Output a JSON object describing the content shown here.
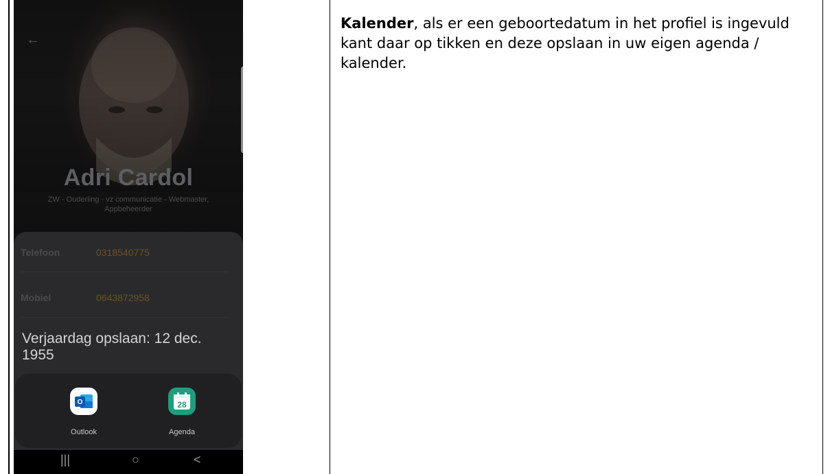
{
  "profile": {
    "name": "Adri Cardol",
    "role": "ZW - Ouderling - vz communicatie - Webmaster, Appbeheerder"
  },
  "contact_rows": [
    {
      "label": "Telefoon",
      "value": "0318540775"
    },
    {
      "label": "Mobiel",
      "value": "0643872958"
    }
  ],
  "toast": {
    "text": "Verjaardag opslaan: 12 dec. 1955"
  },
  "share_apps": [
    {
      "label": "Outlook",
      "icon": "outlook-icon"
    },
    {
      "label": "Agenda",
      "icon": "calendar-icon",
      "badge": "28"
    }
  ],
  "nav": {
    "recents": "|||",
    "home": "○",
    "back": "<"
  },
  "description": {
    "bold": "Kalender",
    "rest": ", als er een geboortedatum in het profiel is ingevuld kant daar op tikken en deze opslaan in uw eigen agenda / kalender."
  },
  "colors": {
    "agenda_green": "#1f9e7e",
    "outlook_blue": "#1066c4",
    "value_gold": "#6b531f"
  }
}
